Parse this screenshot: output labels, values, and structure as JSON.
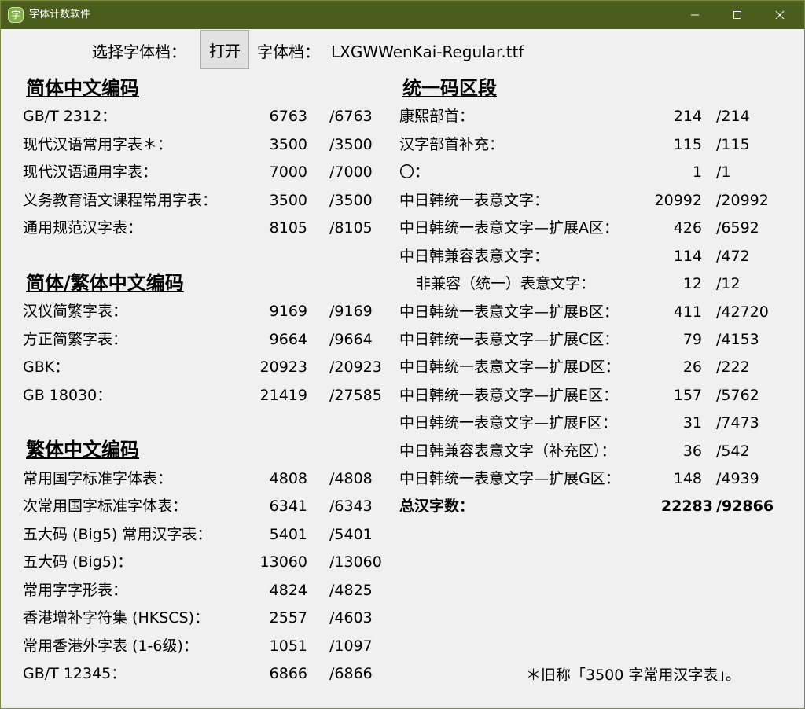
{
  "window": {
    "title": "字体计数软件",
    "icon": "app-font-counter-icon",
    "accent_color": "#4b5d1c"
  },
  "toolbar": {
    "select_label": "选择字体档：",
    "open_button": "打开",
    "file_label": "字体档：",
    "file_name": "LXGWWenKai-Regular.ttf"
  },
  "simplified": {
    "heading": "简体中文编码",
    "rows": [
      {
        "label": "GB/T 2312：",
        "count": "6763",
        "total": "/6763"
      },
      {
        "label": "现代汉语常用字表＊：",
        "count": "3500",
        "total": "/3500"
      },
      {
        "label": "现代汉语通用字表：",
        "count": "7000",
        "total": "/7000"
      },
      {
        "label": "义务教育语文课程常用字表：",
        "count": "3500",
        "total": "/3500"
      },
      {
        "label": "通用规范汉字表：",
        "count": "8105",
        "total": "/8105"
      }
    ]
  },
  "simp_trad": {
    "heading": "简体/繁体中文编码",
    "rows": [
      {
        "label": "汉仪简繁字表：",
        "count": "9169",
        "total": "/9169"
      },
      {
        "label": "方正简繁字表：",
        "count": "9664",
        "total": "/9664"
      },
      {
        "label": "GBK：",
        "count": "20923",
        "total": "/20923"
      },
      {
        "label": "GB 18030：",
        "count": "21419",
        "total": "/27585"
      }
    ]
  },
  "traditional": {
    "heading": "繁体中文编码",
    "rows": [
      {
        "label": "常用国字标准字体表：",
        "count": "4808",
        "total": "/4808"
      },
      {
        "label": "次常用国字标准字体表：",
        "count": "6341",
        "total": "/6343"
      },
      {
        "label": "五大码 (Big5) 常用汉字表：",
        "count": "5401",
        "total": "/5401"
      },
      {
        "label": "五大码 (Big5)：",
        "count": "13060",
        "total": "/13060"
      },
      {
        "label": "常用字字形表：",
        "count": "4824",
        "total": "/4825"
      },
      {
        "label": "香港增补字符集 (HKSCS)：",
        "count": "2557",
        "total": "/4603"
      },
      {
        "label": "常用香港外字表 (1-6级)：",
        "count": "1051",
        "total": "/1097"
      },
      {
        "label": "GB/T 12345：",
        "count": "6866",
        "total": "/6866"
      }
    ]
  },
  "unicode": {
    "heading": "统一码区段",
    "rows": [
      {
        "label": "康熙部首：",
        "count": "214",
        "total": "/214"
      },
      {
        "label": "汉字部首补充：",
        "count": "115",
        "total": "/115"
      },
      {
        "label": "〇：",
        "count": "1",
        "total": "/1"
      },
      {
        "label": "中日韩统一表意文字：",
        "count": "20992",
        "total": "/20992"
      },
      {
        "label": "中日韩统一表意文字—扩展A区：",
        "count": "426",
        "total": "/6592"
      },
      {
        "label": "中日韩兼容表意文字：",
        "count": "114",
        "total": "/472"
      },
      {
        "label": "非兼容（统一）表意文字：",
        "count": "12",
        "total": "/12"
      },
      {
        "label": "中日韩统一表意文字—扩展B区：",
        "count": "411",
        "total": "/42720"
      },
      {
        "label": "中日韩统一表意文字—扩展C区：",
        "count": "79",
        "total": "/4153"
      },
      {
        "label": "中日韩统一表意文字—扩展D区：",
        "count": "26",
        "total": "/222"
      },
      {
        "label": "中日韩统一表意文字—扩展E区：",
        "count": "157",
        "total": "/5762"
      },
      {
        "label": "中日韩统一表意文字—扩展F区：",
        "count": "31",
        "total": "/7473"
      },
      {
        "label": "中日韩兼容表意文字（补充区）：",
        "count": "36",
        "total": "/542"
      },
      {
        "label": "中日韩统一表意文字—扩展G区：",
        "count": "148",
        "total": "/4939"
      }
    ],
    "grand_total": {
      "label": "总汉字数：",
      "count": "22283",
      "total": "/92866"
    }
  },
  "footnote": "＊旧称「3500 字常用汉字表」。"
}
